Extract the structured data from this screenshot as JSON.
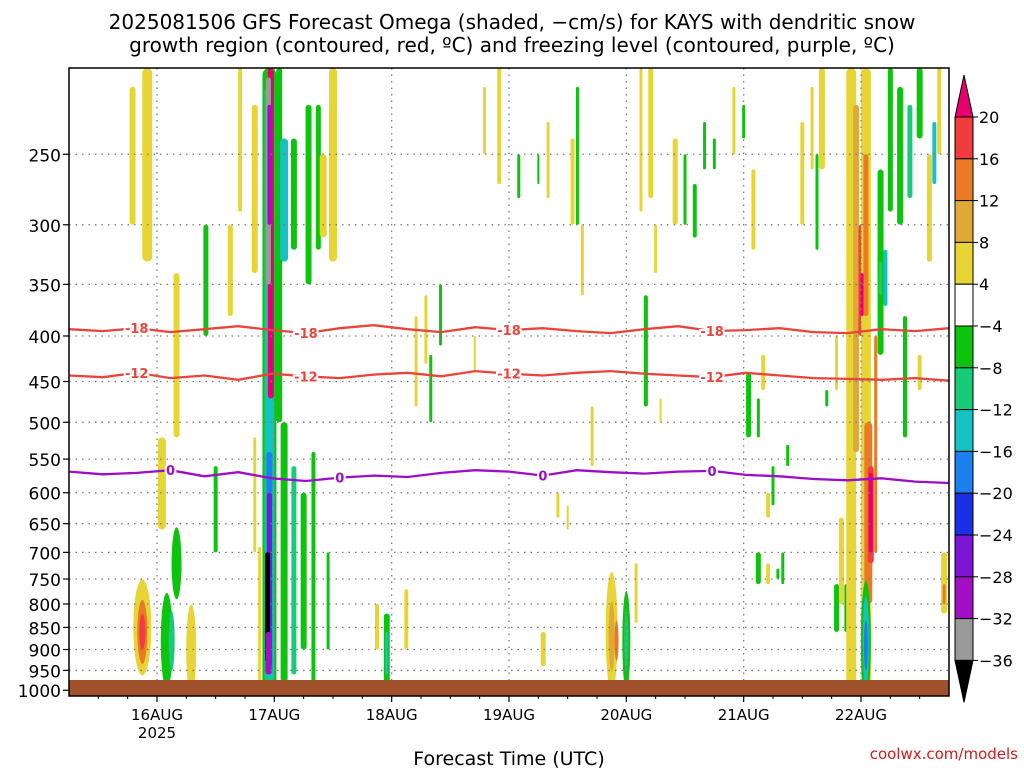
{
  "title_line1": "2025081506 GFS Forecast Omega (shaded, −cm/s) for KAYS with dendritic snow",
  "title_line2": "growth region (contoured, red, ºC) and freezing level (contoured, purple, ºC)",
  "xlabel": "Forecast Time (UTC)",
  "credit": "coolwx.com/models",
  "colors": {
    "grid": "#7a7a7a",
    "ground": "#a0522d",
    "dgz_line": "#e8453c",
    "freezing_line": "#9c0fc8",
    "credit": "#d11a1a"
  },
  "chart_data": {
    "type": "heatmap",
    "title": "2025081506 GFS Forecast Omega (shaded, −cm/s) for KAYS with dendritic snow growth region (contoured, red, ºC) and freezing level (contoured, purple, ºC)",
    "xlabel": "Forecast Time (UTC)",
    "ylabel": "",
    "y_scale": "log-pressure (inverted)",
    "y_ticks": [
      250,
      300,
      350,
      400,
      450,
      500,
      550,
      600,
      650,
      700,
      750,
      800,
      850,
      900,
      950,
      1000
    ],
    "ylim": [
      1015,
      200
    ],
    "x_ticks": [
      {
        "label": "16AUG",
        "sublabel": "2025",
        "hour": 18
      },
      {
        "label": "17AUG",
        "sublabel": "",
        "hour": 42
      },
      {
        "label": "18AUG",
        "sublabel": "",
        "hour": 66
      },
      {
        "label": "19AUG",
        "sublabel": "",
        "hour": 90
      },
      {
        "label": "20AUG",
        "sublabel": "",
        "hour": 114
      },
      {
        "label": "21AUG",
        "sublabel": "",
        "hour": 138
      },
      {
        "label": "22AUG",
        "sublabel": "",
        "hour": 162
      }
    ],
    "x_range_hours": [
      0,
      180
    ],
    "colorbar": {
      "labels": [
        "20",
        "16",
        "12",
        "8",
        "4",
        "−4",
        "−8",
        "−12",
        "−16",
        "−20",
        "−24",
        "−28",
        "−32",
        "−36"
      ],
      "colors": [
        "#e6006e",
        "#f03c3c",
        "#ea7a25",
        "#e2a837",
        "#e6d534",
        "#ffffff",
        "#0cc40c",
        "#16cc78",
        "#14c2c2",
        "#1b7ff0",
        "#1b2fe6",
        "#7b16d6",
        "#a20fc4",
        "#9a9a9a",
        "#000000"
      ]
    },
    "contours": [
      {
        "label": "-18",
        "color": "red",
        "pressures": [
          393,
          395,
          392,
          396,
          393,
          390,
          394,
          397,
          392,
          389,
          393,
          396,
          391,
          394,
          392,
          395,
          397,
          393,
          390,
          395,
          394,
          392,
          396,
          397,
          393,
          395,
          392
        ]
      },
      {
        "label": "-12",
        "color": "red",
        "pressures": [
          443,
          445,
          440,
          446,
          443,
          448,
          441,
          444,
          446,
          442,
          440,
          444,
          438,
          441,
          443,
          440,
          438,
          441,
          443,
          445,
          440,
          443,
          446,
          447,
          448,
          446,
          449
        ]
      },
      {
        "label": "0",
        "color": "purple",
        "pressures": [
          568,
          572,
          570,
          566,
          575,
          569,
          578,
          582,
          577,
          574,
          576,
          570,
          566,
          568,
          574,
          566,
          569,
          571,
          568,
          567,
          573,
          575,
          579,
          581,
          578,
          583,
          585
        ]
      }
    ],
    "features": [
      {
        "name": "17AUG strong upward motion",
        "hour": 41,
        "p_top": 200,
        "p_bottom": 990,
        "peak_omega": "−36 or stronger"
      },
      {
        "name": "22AUG upward motion column",
        "hour": 163,
        "p_top": 210,
        "p_bottom": 985,
        "peak_omega": "−16"
      },
      {
        "name": "22AUG descent core",
        "hour": 163,
        "p_top": 560,
        "p_bottom": 720,
        "peak_omega": "16"
      }
    ]
  }
}
